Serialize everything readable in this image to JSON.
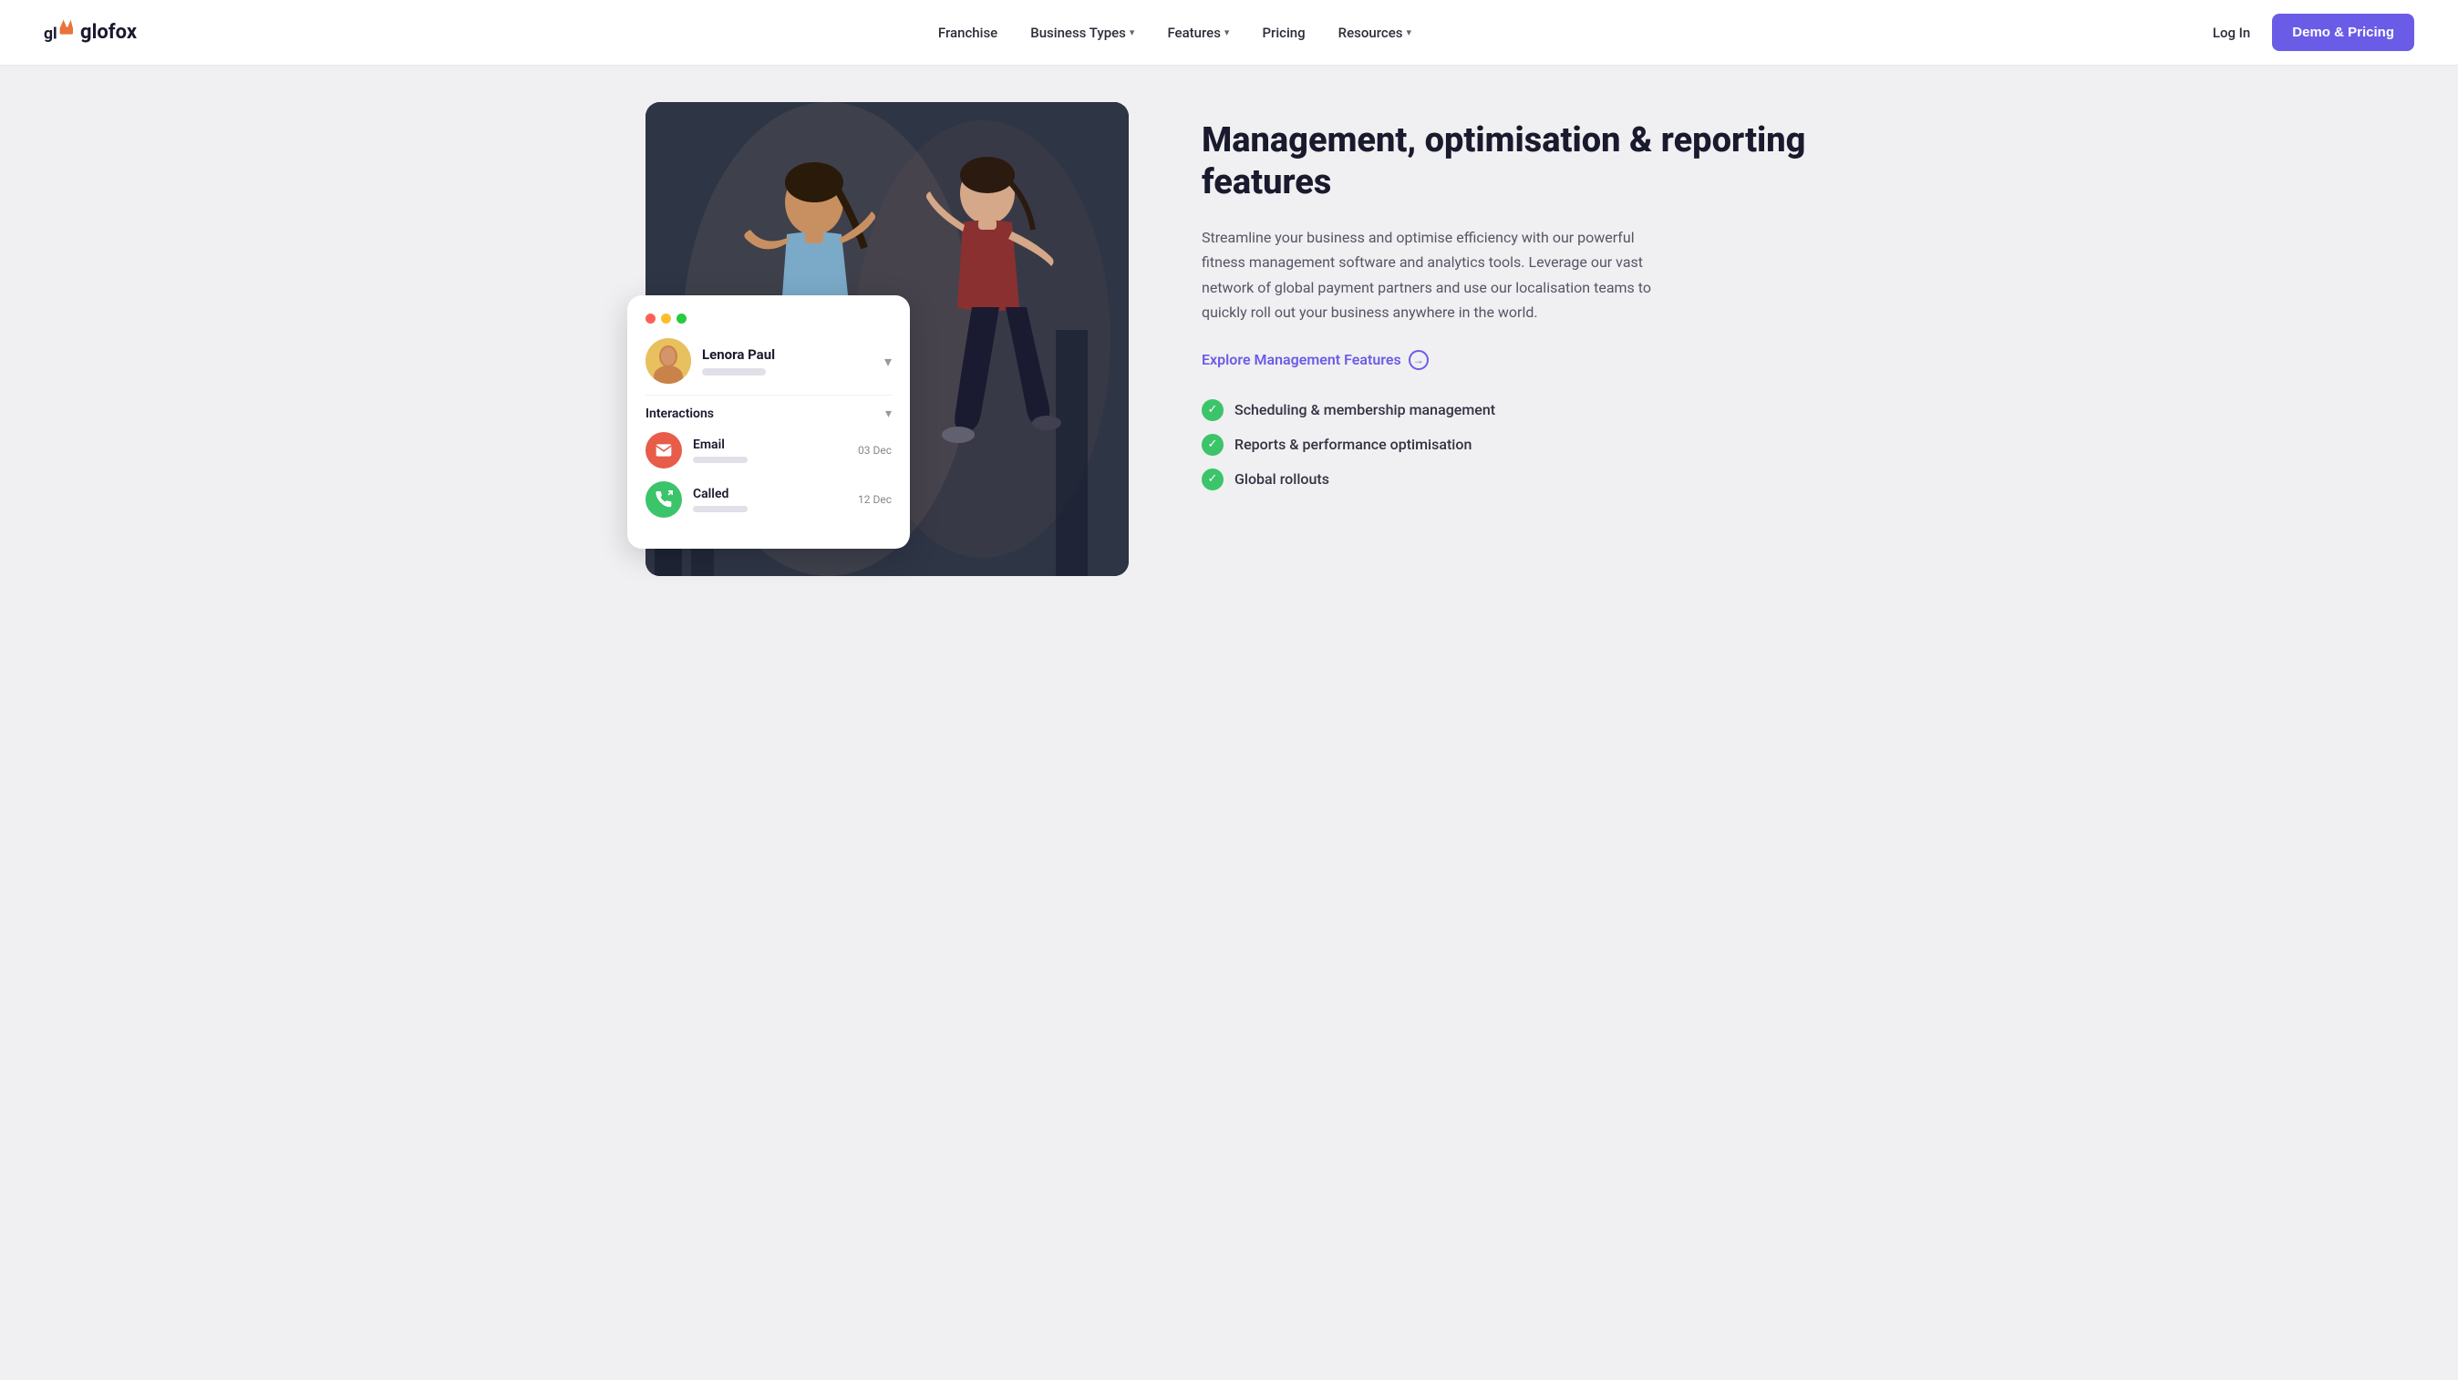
{
  "nav": {
    "logo_text": "glofox",
    "links": [
      {
        "label": "Franchise",
        "has_dropdown": false
      },
      {
        "label": "Business Types",
        "has_dropdown": true
      },
      {
        "label": "Features",
        "has_dropdown": true
      },
      {
        "label": "Pricing",
        "has_dropdown": false
      },
      {
        "label": "Resources",
        "has_dropdown": true
      }
    ],
    "login_label": "Log In",
    "cta_label": "Demo & Pricing"
  },
  "card": {
    "window_dots": [
      "red",
      "yellow",
      "green"
    ],
    "user_name": "Lenora Paul",
    "interactions_label": "Interactions",
    "email_label": "Email",
    "email_date": "03 Dec",
    "called_label": "Called",
    "called_date": "12 Dec"
  },
  "hero": {
    "title": "Management, optimisation & reporting features",
    "description": "Streamline your business and optimise efficiency with our powerful fitness management software and analytics tools. Leverage our vast network of global payment partners and use our localisation teams to quickly roll out your business anywhere in the world.",
    "explore_link": "Explore Management Features",
    "features": [
      "Scheduling & membership management",
      "Reports & performance optimisation",
      "Global rollouts"
    ]
  }
}
